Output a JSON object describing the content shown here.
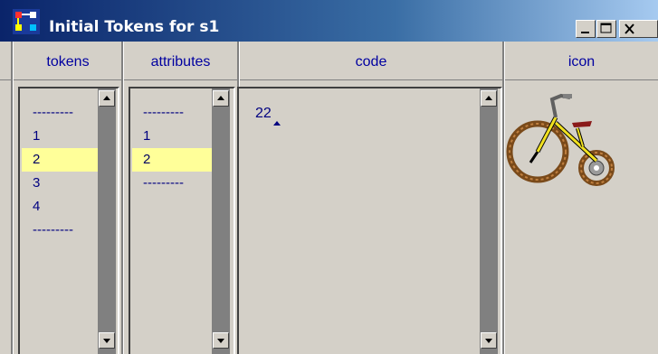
{
  "window": {
    "title": "Initial Tokens for s1",
    "icon": "app-icon",
    "caption_buttons": [
      "minimize",
      "maximize",
      "close"
    ]
  },
  "columns": {
    "tokens": "tokens",
    "attributes": "attributes",
    "code": "code",
    "icon": "icon"
  },
  "tokens_list": {
    "items": [
      "---------",
      "1",
      "2",
      "3",
      "4",
      "---------"
    ],
    "selected": "2"
  },
  "attributes_list": {
    "items": [
      "---------",
      "1",
      "2",
      "---------"
    ],
    "selected": "2"
  },
  "code_area": {
    "text": "22"
  },
  "icon_preview": {
    "name": "tricycle-icon"
  },
  "colors": {
    "title_gradient_start": "#0a246a",
    "title_gradient_end": "#a6caf0",
    "window_bg": "#d4d0c8",
    "header_text": "#0000a0",
    "selection_bg": "#ffff99",
    "scrollbar_track": "#808080"
  }
}
